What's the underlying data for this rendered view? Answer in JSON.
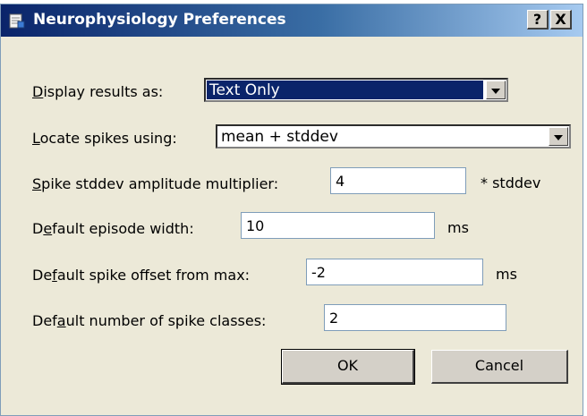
{
  "window": {
    "title": "Neurophysiology Preferences",
    "icon": "preferences-app-icon",
    "help_label": "?",
    "close_label": "X"
  },
  "form": {
    "display_results": {
      "label_prefix": "",
      "label_accel": "D",
      "label_rest": "isplay results as:",
      "value": "Text Only"
    },
    "locate_spikes": {
      "label_prefix": "",
      "label_accel": "L",
      "label_rest": "ocate spikes using:",
      "value": "mean + stddev"
    },
    "multiplier": {
      "label_prefix": "",
      "label_accel": "S",
      "label_rest": "pike stddev amplitude multiplier:",
      "value": "4",
      "unit": "* stddev"
    },
    "episode_width": {
      "label_prefix": "D",
      "label_accel": "e",
      "label_rest": "fault episode width:",
      "value": "10",
      "unit": "ms"
    },
    "spike_offset": {
      "label_prefix": "De",
      "label_accel": "f",
      "label_rest": "ault spike offset from max:",
      "value": "-2",
      "unit": "ms"
    },
    "spike_classes": {
      "label_prefix": "Def",
      "label_accel": "a",
      "label_rest": "ult number of spike classes:",
      "value": "2"
    }
  },
  "buttons": {
    "ok": "OK",
    "cancel": "Cancel"
  }
}
